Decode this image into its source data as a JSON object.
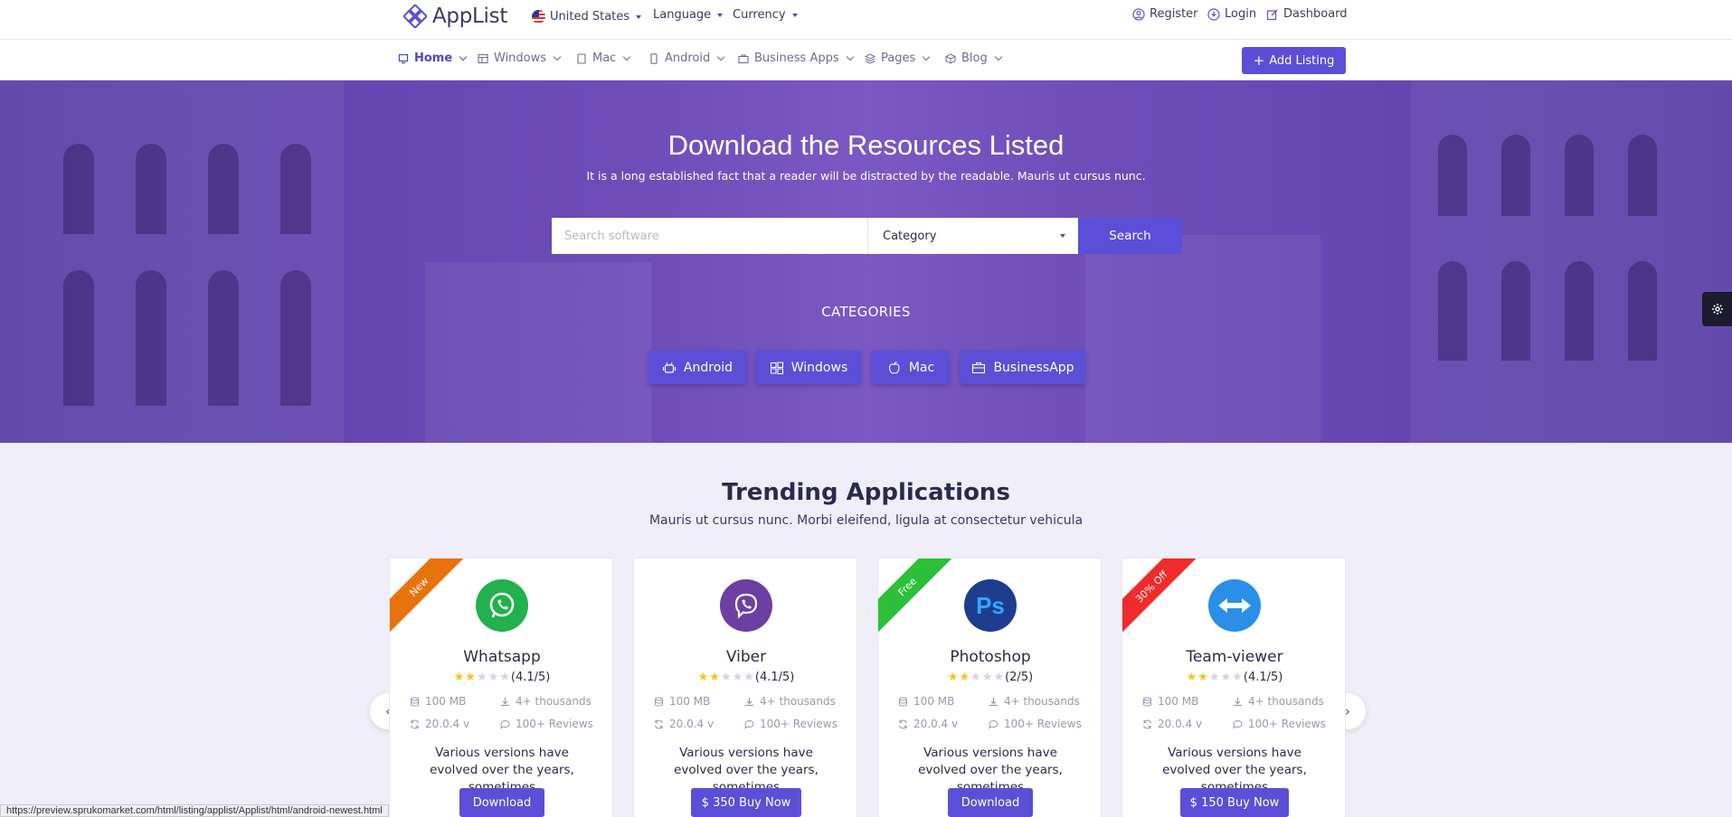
{
  "topbar": {
    "logo": "AppList",
    "country": "United States",
    "language": "Language",
    "currency": "Currency",
    "register": "Register",
    "login": "Login",
    "dashboard": "Dashboard"
  },
  "nav": {
    "items": [
      "Home",
      "Windows",
      "Mac",
      "Android",
      "Business Apps",
      "Pages",
      "Blog"
    ],
    "add_listing": "Add Listing"
  },
  "hero": {
    "title": "Download the Resources Listed",
    "subtitle": "It is a long established fact that a reader will be distracted by the readable. Mauris ut cursus nunc.",
    "search_placeholder": "Search software",
    "category_label": "Category",
    "search_button": "Search",
    "categories_title": "CATEGORIES",
    "categories": [
      "Android",
      "Windows",
      "Mac",
      "BusinessApp"
    ]
  },
  "trending": {
    "title": "Trending Applications",
    "subtitle": "Mauris ut cursus nunc. Morbi eleifend, ligula at consectetur vehicula",
    "cards": [
      {
        "ribbon": "New",
        "ribbon_color": "#e8730c",
        "name": "Whatsapp",
        "icon_color": "#22b14c",
        "rating_text": "(4.1/5)",
        "stars": 2,
        "size": "100 MB",
        "downloads": "4+ thousands",
        "version": "20.0.4 v",
        "reviews": "100+ Reviews",
        "desc": "Various versions have evolved over the years, sometimes",
        "button": "Download"
      },
      {
        "ribbon": "",
        "ribbon_color": "",
        "name": "Viber",
        "icon_color": "#6d3fa3",
        "rating_text": "(4.1/5)",
        "stars": 2,
        "size": "100 MB",
        "downloads": "4+ thousands",
        "version": "20.0.4 v",
        "reviews": "100+ Reviews",
        "desc": "Various versions have evolved over the years, sometimes",
        "button": "$ 350 Buy Now"
      },
      {
        "ribbon": "Free",
        "ribbon_color": "#2cc03a",
        "name": "Photoshop",
        "icon_color": "#1f3d8f",
        "rating_text": "(2/5)",
        "stars": 2,
        "size": "100 MB",
        "downloads": "4+ thousands",
        "version": "20.0.4 v",
        "reviews": "100+ Reviews",
        "desc": "Various versions have evolved over the years, sometimes",
        "button": "Download"
      },
      {
        "ribbon": "30% Off",
        "ribbon_color": "#ef2b2b",
        "name": "Team-viewer",
        "icon_color": "#2a8fe6",
        "rating_text": "(4.1/5)",
        "stars": 2,
        "size": "100 MB",
        "downloads": "4+ thousands",
        "version": "20.0.4 v",
        "reviews": "100+ Reviews",
        "desc": "Various versions have evolved over the years, sometimes",
        "button": "$ 150 Buy Now"
      }
    ]
  },
  "status_url": "https://preview.sprukomarket.com/html/listing/applist/Applist/html/android-newest.html",
  "colors": {
    "accent": "#5b4fd8"
  }
}
